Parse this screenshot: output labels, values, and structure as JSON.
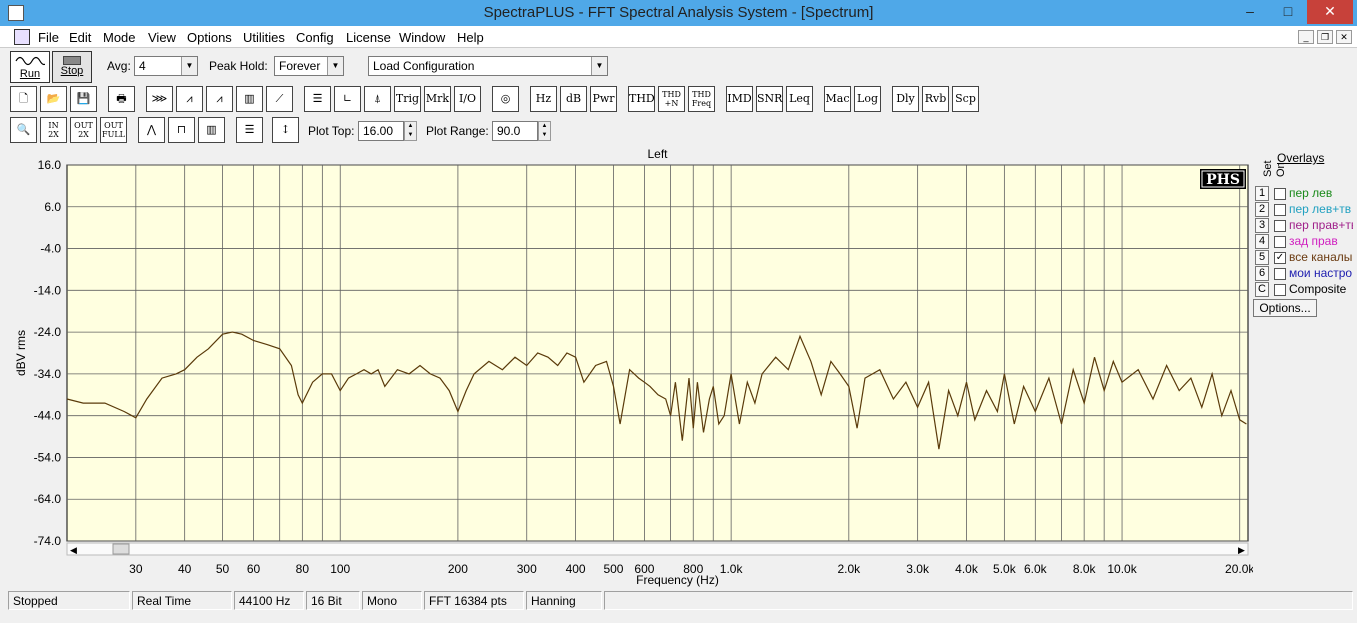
{
  "window": {
    "title": "SpectraPLUS - FFT Spectral Analysis System - [Spectrum]",
    "minimize": "–",
    "maximize": "□",
    "close": "✕"
  },
  "menu": [
    "File",
    "Edit",
    "Mode",
    "View",
    "Options",
    "Utilities",
    "Config",
    "License",
    "Window",
    "Help"
  ],
  "toolbar1": {
    "run_label": "Run",
    "stop_label": "Stop",
    "avg_label": "Avg:",
    "avg_value": "4",
    "peak_hold_label": "Peak Hold:",
    "peak_hold_value": "Forever",
    "config_value": "Load Configuration"
  },
  "toolbar2": {
    "text_buttons": [
      "Trig",
      "Mrk",
      "I/O",
      "Hz",
      "dB",
      "Pwr",
      "THD",
      "IMD",
      "SNR",
      "Leq",
      "Mac",
      "Log",
      "Dly",
      "Rvb",
      "Scp"
    ],
    "thd_n": "THD\n+N",
    "thd_freq": "THD\nFreq"
  },
  "toolbar3": {
    "zoom_in": "IN\n2X",
    "zoom_out": "OUT\n2X",
    "zoom_full": "OUT\nFULL",
    "plot_top_label": "Plot Top:",
    "plot_top_value": "16.00",
    "plot_range_label": "Plot Range:",
    "plot_range_value": "90.0"
  },
  "chart_data": {
    "type": "line",
    "title": "Left",
    "xlabel": "Frequency (Hz)",
    "ylabel": "dBV rms",
    "xscale": "log",
    "xlim": [
      20,
      21000
    ],
    "ylim": [
      -74,
      16
    ],
    "yticks": [
      "16.0",
      "6.0",
      "-4.0",
      "-14.0",
      "-24.0",
      "-34.0",
      "-44.0",
      "-54.0",
      "-64.0",
      "-74.0"
    ],
    "xticks": [
      "30",
      "40",
      "50",
      "60",
      "80",
      "100",
      "200",
      "300",
      "400",
      "500",
      "600",
      "800",
      "1.0k",
      "2.0k",
      "3.0k",
      "4.0k",
      "5.0k",
      "6.0k",
      "8.0k",
      "10.0k",
      "20.0k"
    ],
    "xtick_values": [
      30,
      40,
      50,
      60,
      80,
      100,
      200,
      300,
      400,
      500,
      600,
      800,
      1000,
      2000,
      3000,
      4000,
      5000,
      6000,
      8000,
      10000,
      20000
    ],
    "badge": "PHS",
    "background_color": "#ffffe0",
    "line_color": "#5a3a0a",
    "series": [
      {
        "x": [
          20,
          22,
          25,
          28,
          30,
          32,
          35,
          38,
          40,
          43,
          46,
          50,
          53,
          56,
          60,
          65,
          70,
          75,
          78,
          80,
          85,
          90,
          95,
          100,
          105,
          110,
          115,
          120,
          125,
          130,
          140,
          150,
          160,
          170,
          180,
          190,
          200,
          210,
          220,
          240,
          260,
          280,
          300,
          320,
          340,
          360,
          380,
          400,
          420,
          450,
          480,
          500,
          520,
          550,
          580,
          600,
          620,
          650,
          680,
          700,
          720,
          750,
          780,
          800,
          820,
          850,
          880,
          900,
          930,
          960,
          1000,
          1050,
          1100,
          1150,
          1200,
          1300,
          1400,
          1500,
          1600,
          1700,
          1800,
          1900,
          2000,
          2100,
          2200,
          2400,
          2600,
          2800,
          3000,
          3200,
          3400,
          3600,
          3800,
          4000,
          4200,
          4500,
          4800,
          5000,
          5300,
          5600,
          6000,
          6500,
          7000,
          7500,
          8000,
          8500,
          9000,
          9500,
          10000,
          11000,
          12000,
          13000,
          14000,
          15000,
          16000,
          17000,
          18000,
          19000,
          20000,
          20800
        ],
        "y": [
          -40,
          -41,
          -41,
          -43,
          -44.5,
          -40,
          -35,
          -34,
          -33,
          -30,
          -28,
          -24.5,
          -24,
          -24.5,
          -26,
          -27,
          -28,
          -32,
          -39,
          -41,
          -36,
          -34,
          -34,
          -38,
          -35,
          -34,
          -33,
          -34,
          -33,
          -37,
          -33,
          -34,
          -32,
          -34,
          -35,
          -38,
          -43,
          -38,
          -34,
          -31,
          -33,
          -30,
          -32,
          -29,
          -30,
          -32,
          -29,
          -30,
          -36,
          -32,
          -31,
          -37,
          -46,
          -33,
          -35,
          -36,
          -37,
          -39,
          -40,
          -44,
          -36,
          -50,
          -35,
          -47,
          -36,
          -48,
          -40,
          -37,
          -46,
          -44,
          -34,
          -46,
          -36,
          -41,
          -34,
          -30,
          -33,
          -25,
          -31,
          -39,
          -31,
          -34,
          -37,
          -47,
          -35,
          -33,
          -40,
          -36,
          -42,
          -36,
          -52,
          -38,
          -44,
          -36,
          -45,
          -38,
          -43,
          -34,
          -46,
          -37,
          -43,
          -35,
          -46,
          -33,
          -41,
          -30,
          -38,
          -31,
          -36,
          -33,
          -40,
          -32,
          -38,
          -35,
          -42,
          -34,
          -44,
          -38,
          -45,
          -46
        ]
      }
    ]
  },
  "overlays": {
    "title": "Overlays",
    "set_label": "Set",
    "on_label": "On",
    "items": [
      {
        "num": "1",
        "checked": "",
        "name": "пер лев",
        "color": "#1a8a1a"
      },
      {
        "num": "2",
        "checked": "",
        "name": "пер лев+тв",
        "color": "#20a0c0"
      },
      {
        "num": "3",
        "checked": "",
        "name": "пер прав+тв",
        "color": "#a0208a"
      },
      {
        "num": "4",
        "checked": "",
        "name": "зад прав",
        "color": "#d020c0"
      },
      {
        "num": "5",
        "checked": "✓",
        "name": "все каналы",
        "color": "#6a3a10"
      },
      {
        "num": "6",
        "checked": "",
        "name": "мои настро",
        "color": "#2020b0"
      },
      {
        "num": "C",
        "checked": "",
        "name": "Composite",
        "color": "#000000"
      }
    ],
    "options_button": "Options..."
  },
  "status": [
    "Stopped",
    "Real Time",
    "44100 Hz",
    "16 Bit",
    "Mono",
    "FFT 16384 pts",
    "Hanning",
    ""
  ]
}
